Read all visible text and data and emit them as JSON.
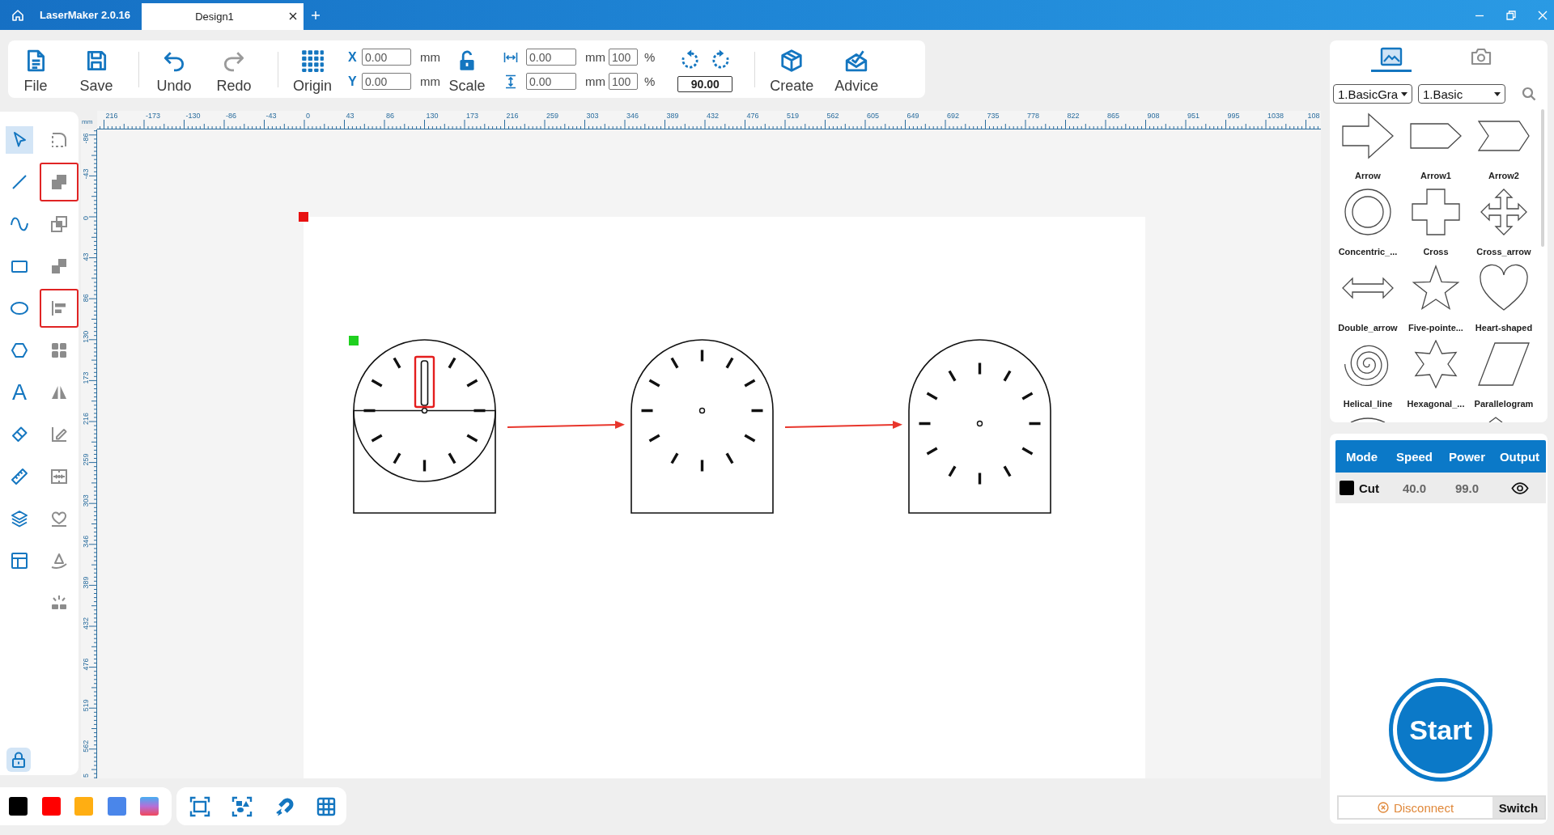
{
  "title_bar": {
    "app_name": "LaserMaker 2.0.16",
    "tabs": [
      {
        "label": "Design1",
        "selected": true
      }
    ]
  },
  "toolbar": {
    "file": {
      "label": "File"
    },
    "save": {
      "label": "Save"
    },
    "undo": {
      "label": "Undo",
      "disabled": false
    },
    "redo": {
      "label": "Redo",
      "disabled": true
    },
    "origin": {
      "label": "Origin"
    },
    "position": {
      "x_label": "X",
      "x_value": "0.00",
      "x_unit": "mm",
      "y_label": "Y",
      "y_value": "0.00",
      "y_unit": "mm"
    },
    "scale": {
      "label": "Scale",
      "locked": false
    },
    "size": {
      "width_value": "0.00",
      "width_unit": "mm",
      "width_percent": "100",
      "width_percent_sign": "%",
      "height_value": "0.00",
      "height_unit": "mm",
      "height_percent": "100",
      "height_percent_sign": "%"
    },
    "rotation": {
      "angle": "90.00"
    },
    "create": {
      "label": "Create"
    },
    "advice": {
      "label": "Advice"
    }
  },
  "tools": {
    "primary": [
      {
        "kind": "select",
        "selected": true,
        "disabled": false,
        "highlighted": false
      },
      {
        "kind": "line",
        "selected": false,
        "disabled": false,
        "highlighted": false
      },
      {
        "kind": "curve",
        "selected": false,
        "disabled": false,
        "highlighted": false
      },
      {
        "kind": "rectangle",
        "selected": false,
        "disabled": false,
        "highlighted": false
      },
      {
        "kind": "ellipse",
        "selected": false,
        "disabled": false,
        "highlighted": false
      },
      {
        "kind": "polygon",
        "selected": false,
        "disabled": false,
        "highlighted": false
      },
      {
        "kind": "text",
        "glyph": "A",
        "selected": false,
        "disabled": false,
        "highlighted": false
      },
      {
        "kind": "eraser",
        "selected": false,
        "disabled": false,
        "highlighted": false
      },
      {
        "kind": "ruler",
        "selected": false,
        "disabled": false,
        "highlighted": false
      },
      {
        "kind": "layers",
        "selected": false,
        "disabled": false,
        "highlighted": false
      },
      {
        "kind": "layout",
        "selected": false,
        "disabled": false,
        "highlighted": false
      }
    ],
    "secondary": [
      {
        "kind": "node",
        "selected": false,
        "disabled": true,
        "highlighted": false
      },
      {
        "kind": "combine",
        "selected": false,
        "disabled": true,
        "highlighted": true
      },
      {
        "kind": "overlap",
        "selected": false,
        "disabled": true,
        "highlighted": false
      },
      {
        "kind": "subtract",
        "selected": false,
        "disabled": true,
        "highlighted": false
      },
      {
        "kind": "align",
        "selected": false,
        "disabled": true,
        "highlighted": true
      },
      {
        "kind": "array",
        "selected": false,
        "disabled": true,
        "highlighted": false
      },
      {
        "kind": "mirror",
        "selected": false,
        "disabled": true,
        "highlighted": false
      },
      {
        "kind": "edit",
        "selected": false,
        "disabled": true,
        "highlighted": false
      },
      {
        "kind": "split",
        "selected": false,
        "disabled": true,
        "highlighted": false
      },
      {
        "kind": "outline",
        "selected": false,
        "disabled": true,
        "highlighted": false
      },
      {
        "kind": "pathtext",
        "selected": false,
        "disabled": true,
        "highlighted": false
      },
      {
        "kind": "burst",
        "selected": false,
        "disabled": true,
        "highlighted": false
      }
    ],
    "lock": {
      "selected": true
    }
  },
  "rulers": {
    "unit": "mm",
    "horizontal": [
      "216",
      "-173",
      "-130",
      "-86",
      "-43",
      "0",
      "43",
      "86",
      "130",
      "173",
      "216",
      "259",
      "303",
      "346",
      "389",
      "432",
      "476",
      "519",
      "562",
      "605",
      "649",
      "692",
      "735",
      "778",
      "822",
      "865",
      "908",
      "951",
      "995",
      "1038",
      "108"
    ],
    "vertical": [
      "-86",
      "-43",
      "0",
      "43",
      "86",
      "130",
      "173",
      "216",
      "259",
      "303",
      "346",
      "389",
      "432",
      "476",
      "519",
      "562",
      "5"
    ]
  },
  "canvas": {
    "designs": [
      {
        "kind": "split",
        "slot": true,
        "dial_lowered": false
      },
      {
        "kind": "arch",
        "slot": false,
        "dial_lowered": false
      },
      {
        "kind": "arch",
        "slot": false,
        "dial_lowered": true
      }
    ]
  },
  "library": {
    "tabs": [
      {
        "kind": "graphics",
        "selected": true
      },
      {
        "kind": "camera",
        "selected": false
      }
    ],
    "category": "1.BasicGra",
    "subcategory": "1.Basic",
    "shapes": [
      {
        "kind": "arrow",
        "label": "Arrow"
      },
      {
        "kind": "tag",
        "label": "Arrow1"
      },
      {
        "kind": "chevron",
        "label": "Arrow2"
      },
      {
        "kind": "rings",
        "label": "Concentric_..."
      },
      {
        "kind": "cross",
        "label": "Cross"
      },
      {
        "kind": "move",
        "label": "Cross_arrow"
      },
      {
        "kind": "double",
        "label": "Double_arrow"
      },
      {
        "kind": "star",
        "label": "Five-pointe..."
      },
      {
        "kind": "heart",
        "label": "Heart-shaped"
      },
      {
        "kind": "spiral",
        "label": "Helical_line"
      },
      {
        "kind": "hexagram",
        "label": "Hexagonal_..."
      },
      {
        "kind": "parallelogram",
        "label": "Parallelogram"
      }
    ],
    "partial_shapes": [
      {
        "kind": "arc"
      },
      {
        "kind": "peak"
      }
    ]
  },
  "layers": {
    "columns": [
      "Mode",
      "Speed",
      "Power",
      "Output"
    ],
    "rows": [
      {
        "color": "#000000",
        "mode": "Cut",
        "speed": "40.0",
        "power": "99.0",
        "visible": true
      }
    ]
  },
  "start": {
    "label": "Start"
  },
  "connection": {
    "status": "Disconnect",
    "switch": "Switch"
  },
  "palette": [
    {
      "kind": "solid",
      "color": "#000000"
    },
    {
      "kind": "solid",
      "color": "#ff0000"
    },
    {
      "kind": "solid",
      "color": "#ffae12"
    },
    {
      "kind": "solid",
      "color": "#4a86ea"
    },
    {
      "kind": "gradient"
    }
  ]
}
